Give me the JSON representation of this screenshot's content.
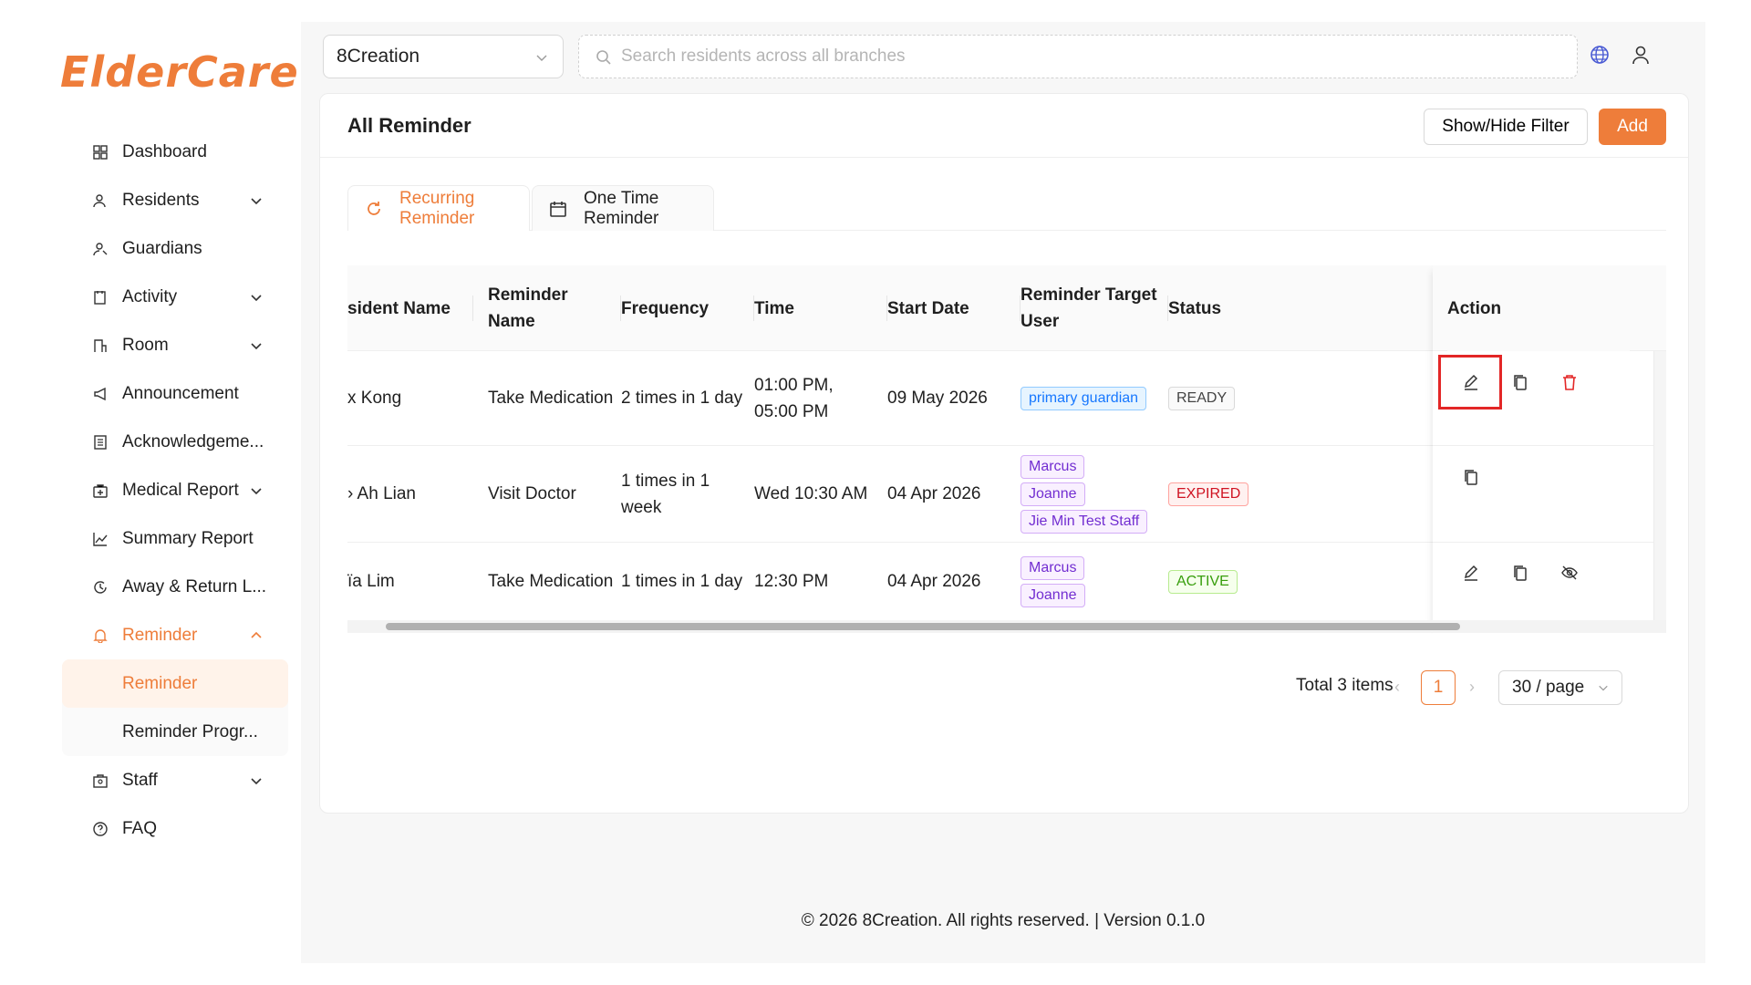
{
  "app": {
    "logo_main": "ElderCare",
    "logo_plus": "+"
  },
  "sidebar": {
    "items": [
      {
        "label": "Dashboard",
        "icon": "dashboard-icon",
        "has_chevron": false
      },
      {
        "label": "Residents",
        "icon": "residents-icon",
        "has_chevron": true
      },
      {
        "label": "Guardians",
        "icon": "guardians-icon",
        "has_chevron": false
      },
      {
        "label": "Activity",
        "icon": "activity-icon",
        "has_chevron": true
      },
      {
        "label": "Room",
        "icon": "room-icon",
        "has_chevron": true
      },
      {
        "label": "Announcement",
        "icon": "announcement-icon",
        "has_chevron": false
      },
      {
        "label": "Acknowledgeme...",
        "icon": "acknowledgement-icon",
        "has_chevron": false
      },
      {
        "label": "Medical Report",
        "icon": "medical-report-icon",
        "has_chevron": true
      },
      {
        "label": "Summary Report",
        "icon": "summary-report-icon",
        "has_chevron": false
      },
      {
        "label": "Away & Return L...",
        "icon": "away-return-icon",
        "has_chevron": false
      },
      {
        "label": "Reminder",
        "icon": "bell-icon",
        "has_chevron": true,
        "expanded": true,
        "active": true
      }
    ],
    "reminder_sub": [
      {
        "label": "Reminder",
        "selected": true
      },
      {
        "label": "Reminder Progr...",
        "selected": false
      }
    ],
    "items_after": [
      {
        "label": "Staff",
        "icon": "staff-icon",
        "has_chevron": true
      },
      {
        "label": "FAQ",
        "icon": "faq-icon",
        "has_chevron": false
      }
    ]
  },
  "topbar": {
    "branch": "8Creation",
    "search_placeholder": "Search residents across all branches"
  },
  "page": {
    "title": "All Reminder",
    "filter_button": "Show/Hide Filter",
    "add_button": "Add",
    "tabs": [
      {
        "label": "Recurring Reminder",
        "active": true
      },
      {
        "label": "One Time Reminder",
        "active": false
      }
    ]
  },
  "table": {
    "columns": {
      "resident": "sident Name",
      "reminder_l1": "Reminder",
      "reminder_l2": "Name",
      "frequency": "Frequency",
      "time": "Time",
      "start_date": "Start Date",
      "target_l1": "Reminder Target",
      "target_l2": "User",
      "status": "Status",
      "action": "Action"
    },
    "rows": [
      {
        "resident": "x Kong",
        "reminder": "Take Medication",
        "frequency": "2 times in 1 day",
        "time_l1": "01:00 PM,",
        "time_l2": "05:00 PM",
        "start_date": "09 May 2026",
        "targets": [
          "primary guardian"
        ],
        "status": "READY"
      },
      {
        "resident": "› Ah Lian",
        "reminder": "Visit Doctor",
        "frequency_l1": "1 times in 1",
        "frequency_l2": "week",
        "time": "Wed 10:30 AM",
        "start_date": "04 Apr 2026",
        "targets": [
          "Marcus",
          "Joanne",
          "Jie Min Test Staff"
        ],
        "status": "EXPIRED"
      },
      {
        "resident": "ïa Lim",
        "reminder": "Take Medication",
        "frequency": "1 times in 1 day",
        "time": "12:30 PM",
        "start_date": "04 Apr 2026",
        "targets": [
          "Marcus",
          "Joanne"
        ],
        "status": "ACTIVE"
      }
    ]
  },
  "pagination": {
    "total": "Total 3 items",
    "current_page": "1",
    "page_size": "30 / page"
  },
  "footer": {
    "text": "© 2026 8Creation. All rights reserved. | Version 0.1.0"
  },
  "colors": {
    "accent": "#ee7d3a",
    "highlight": "#e32626",
    "delete": "#e32626"
  }
}
